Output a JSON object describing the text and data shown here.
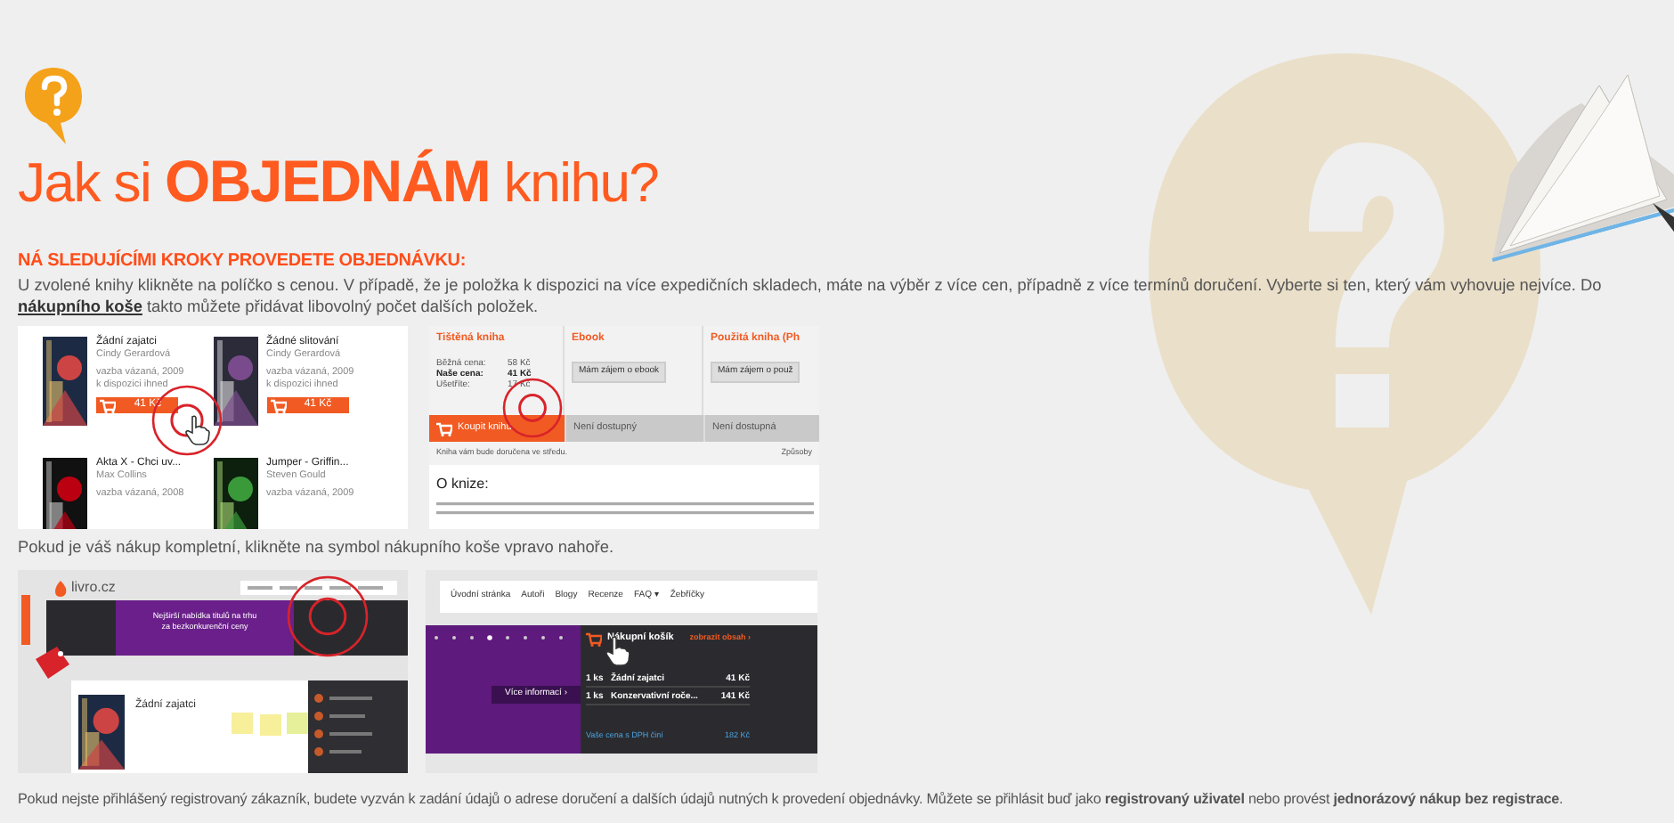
{
  "title": "Jak si **OBJEDNÁM** knihu?",
  "subheading": "NÁ SLEDUJÍCÍMI KROKY PROVEDETE OBJEDNÁVKU:",
  "intro": {
    "before": "U zvolené knihy klikněte na políčko s cenou. V případě, že je položka k dispozici na více expedičních skladech, máte na výběr z více cen, případně z více termínů doručení. Vyberte si ten, který vám vyhovuje nejvíce. Do ",
    "link": "nákupního koše",
    "after": " takto můžete přidávat libovolný počet dalších položek."
  },
  "book_list": {
    "books": [
      {
        "title": "Žádní zajatci",
        "author": "Cindy Gerardová",
        "binding": "vazba vázaná, 2009",
        "availability": "k dispozici ihned",
        "price": "41 Kč"
      },
      {
        "title": "Žádné slitování",
        "author": "Cindy Gerardová",
        "binding": "vazba vázaná, 2009",
        "availability": "k dispozici ihned",
        "price": "41 Kč"
      },
      {
        "title": "Akta X - Chci uv...",
        "author": "Max Collins",
        "binding": "vazba vázaná, 2008"
      },
      {
        "title": "Jumper - Griffin...",
        "author": "Steven Gould",
        "binding": "vazba vázaná, 2009"
      }
    ]
  },
  "book_detail": {
    "columns": [
      {
        "title": "Tištěná kniha",
        "prices": [
          {
            "label": "Běžná cena:",
            "value": "58 Kč",
            "emphasis": false
          },
          {
            "label": "Naše cena:",
            "value": "41 Kč",
            "emphasis": true
          },
          {
            "label": "Ušetříte:",
            "value": "17 Kč",
            "emphasis": false
          }
        ],
        "action": "Koupit knihu",
        "available": true
      },
      {
        "title": "Ebook",
        "button": "Mám zájem o ebook",
        "action": "Není dostupný",
        "available": false
      },
      {
        "title": "Použitá kniha (Ph",
        "button": "Mám zájem o použ",
        "action": "Není dostupná",
        "available": false
      }
    ],
    "delivery": "Kniha vám bude doručena ve středu.",
    "delivery_link": "Způsoby",
    "about": "O knize:"
  },
  "caption_1": "Pokud je váš nákup kompletní, klikněte na symbol nákupního koše vpravo nahoře.",
  "site_overview": {
    "logo": "livro.cz",
    "banner": "Nejširší nabídka titulů na trhu za bezkonkurenční ceny",
    "book_title": "Žádní zajatci"
  },
  "cart_view": {
    "nav": [
      "Úvodní stránka",
      "Autoři",
      "Blogy",
      "Recenze",
      "FAQ ▾",
      "Žebříčky"
    ],
    "cart_title": "Nákupní košík",
    "show_contents": "zobrazit obsah ›",
    "more_info": "Více informací ›",
    "items": [
      {
        "qty": "1 ks",
        "name": "Žádní zajatci",
        "price": "41 Kč"
      },
      {
        "qty": "1 ks",
        "name": "Konzervativní roče...",
        "price": "141 Kč"
      }
    ],
    "total_label": "Vaše cena s DPH činí",
    "total": "182 Kč"
  },
  "caption_2": "Pokud nejste přihlášený registrovaný zákazník, budete vyzván k zadání údajů o adrese doručení a dalších údajů nutných k provedení objednávky. Můžete se přihlásit buď jako **registrovaný uživatel** nebo provést **jednorázový nákup bez registrace**."
}
